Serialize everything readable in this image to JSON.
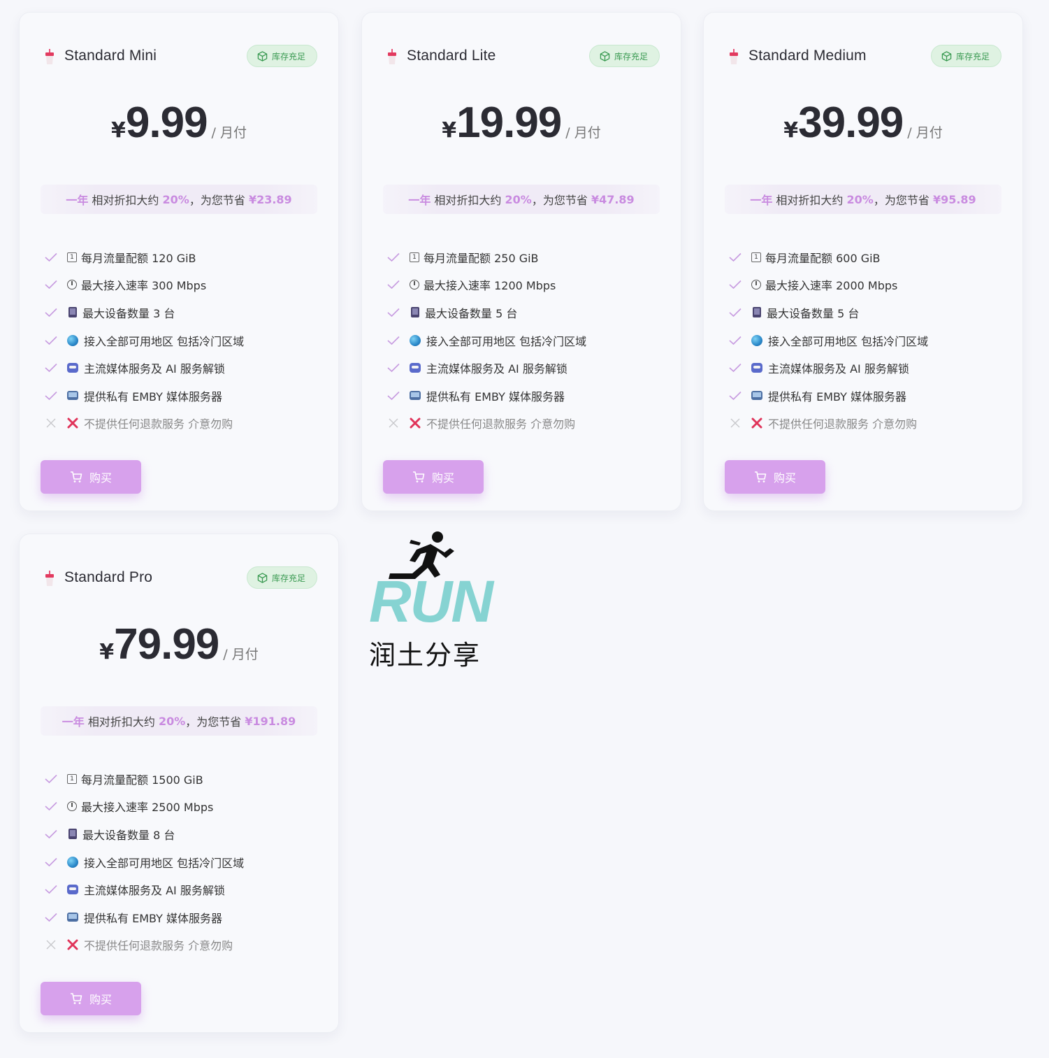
{
  "plans": [
    {
      "name": "Standard Mini",
      "stock": "库存充足",
      "currency": "¥",
      "amount": "9.99",
      "period": "/ 月付",
      "discount": {
        "term": "一年",
        "text1": "相对折扣大约",
        "pct": "20%",
        "text2": "，为您节省",
        "save": "¥23.89"
      },
      "features": [
        "每月流量配额 120 GiB",
        "最大接入速率 300 Mbps",
        "最大设备数量 3 台",
        "接入全部可用地区 包括冷门区域",
        "主流媒体服务及 AI 服务解锁",
        "提供私有 EMBY 媒体服务器",
        "不提供任何退款服务 介意勿购"
      ],
      "buy": "购买"
    },
    {
      "name": "Standard Lite",
      "stock": "库存充足",
      "currency": "¥",
      "amount": "19.99",
      "period": "/ 月付",
      "discount": {
        "term": "一年",
        "text1": "相对折扣大约",
        "pct": "20%",
        "text2": "，为您节省",
        "save": "¥47.89"
      },
      "features": [
        "每月流量配额 250 GiB",
        "最大接入速率 1200 Mbps",
        "最大设备数量 5 台",
        "接入全部可用地区 包括冷门区域",
        "主流媒体服务及 AI 服务解锁",
        "提供私有 EMBY 媒体服务器",
        "不提供任何退款服务 介意勿购"
      ],
      "buy": "购买"
    },
    {
      "name": "Standard Medium",
      "stock": "库存充足",
      "currency": "¥",
      "amount": "39.99",
      "period": "/ 月付",
      "discount": {
        "term": "一年",
        "text1": "相对折扣大约",
        "pct": "20%",
        "text2": "，为您节省",
        "save": "¥95.89"
      },
      "features": [
        "每月流量配额 600 GiB",
        "最大接入速率 2000 Mbps",
        "最大设备数量 5 台",
        "接入全部可用地区 包括冷门区域",
        "主流媒体服务及 AI 服务解锁",
        "提供私有 EMBY 媒体服务器",
        "不提供任何退款服务 介意勿购"
      ],
      "buy": "购买"
    },
    {
      "name": "Standard Pro",
      "stock": "库存充足",
      "currency": "¥",
      "amount": "79.99",
      "period": "/ 月付",
      "discount": {
        "term": "一年",
        "text1": "相对折扣大约",
        "pct": "20%",
        "text2": "，为您节省",
        "save": "¥191.89"
      },
      "features": [
        "每月流量配额 1500 GiB",
        "最大接入速率 2500 Mbps",
        "最大设备数量 8 台",
        "接入全部可用地区 包括冷门区域",
        "主流媒体服务及 AI 服务解锁",
        "提供私有 EMBY 媒体服务器",
        "不提供任何退款服务 介意勿购"
      ],
      "buy": "购买"
    }
  ],
  "feature_icons": [
    "input-numbers-icon",
    "stopwatch-icon",
    "mobile-phone-icon",
    "globe-icon",
    "robot-icon",
    "television-icon",
    "cross-mark-icon"
  ],
  "watermark": {
    "word": "RUN",
    "text": "润土分享"
  },
  "colors": {
    "accent": "#d7a1ec",
    "highlight": "#c98be0",
    "stock_green": "#3a9a52",
    "stock_bg": "#dff2e2",
    "check": "#c79be0",
    "logo_teal": "#86d3d2"
  }
}
